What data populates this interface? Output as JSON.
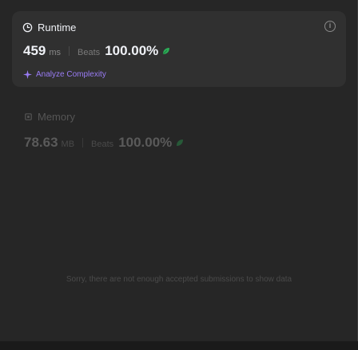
{
  "runtime": {
    "title": "Runtime",
    "value": "459",
    "unit": "ms",
    "beats_label": "Beats",
    "beats_value": "100.00%",
    "analyze_label": "Analyze Complexity"
  },
  "memory": {
    "title": "Memory",
    "value": "78.63",
    "unit": "MB",
    "beats_label": "Beats",
    "beats_value": "100.00%"
  },
  "empty_message": "Sorry, there are not enough accepted submissions to show data",
  "colors": {
    "accent_purple": "#9a7cf5",
    "leaf_green": "#2cbb5d"
  }
}
